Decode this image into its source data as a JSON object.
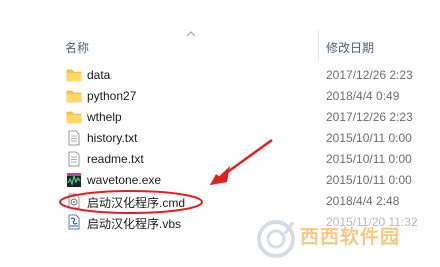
{
  "header": {
    "name_label": "名称",
    "date_label": "修改日期"
  },
  "files": [
    {
      "name": "data",
      "date": "2017/12/26 2:23",
      "icon": "folder-icon"
    },
    {
      "name": "python27",
      "date": "2018/4/4 0:49",
      "icon": "folder-icon"
    },
    {
      "name": "wthelp",
      "date": "2017/12/26 2:23",
      "icon": "folder-icon"
    },
    {
      "name": "history.txt",
      "date": "2015/10/11 0:00",
      "icon": "text-file-icon"
    },
    {
      "name": "readme.txt",
      "date": "2015/10/11 0:00",
      "icon": "text-file-icon"
    },
    {
      "name": "wavetone.exe",
      "date": "2015/10/11 0:00",
      "icon": "exe-icon"
    },
    {
      "name": "启动汉化程序.cmd",
      "date": "2018/4/4 2:48",
      "icon": "cmd-file-icon"
    },
    {
      "name": "启动汉化程序.vbs",
      "date": "2015/11/20 11:32",
      "icon": "vbs-file-icon"
    }
  ],
  "watermark": {
    "text": "西西软件园"
  },
  "colors": {
    "annotation_red": "#e02020",
    "folder_yellow": "#f5c84c",
    "watermark_orange": "#f4c37a"
  }
}
